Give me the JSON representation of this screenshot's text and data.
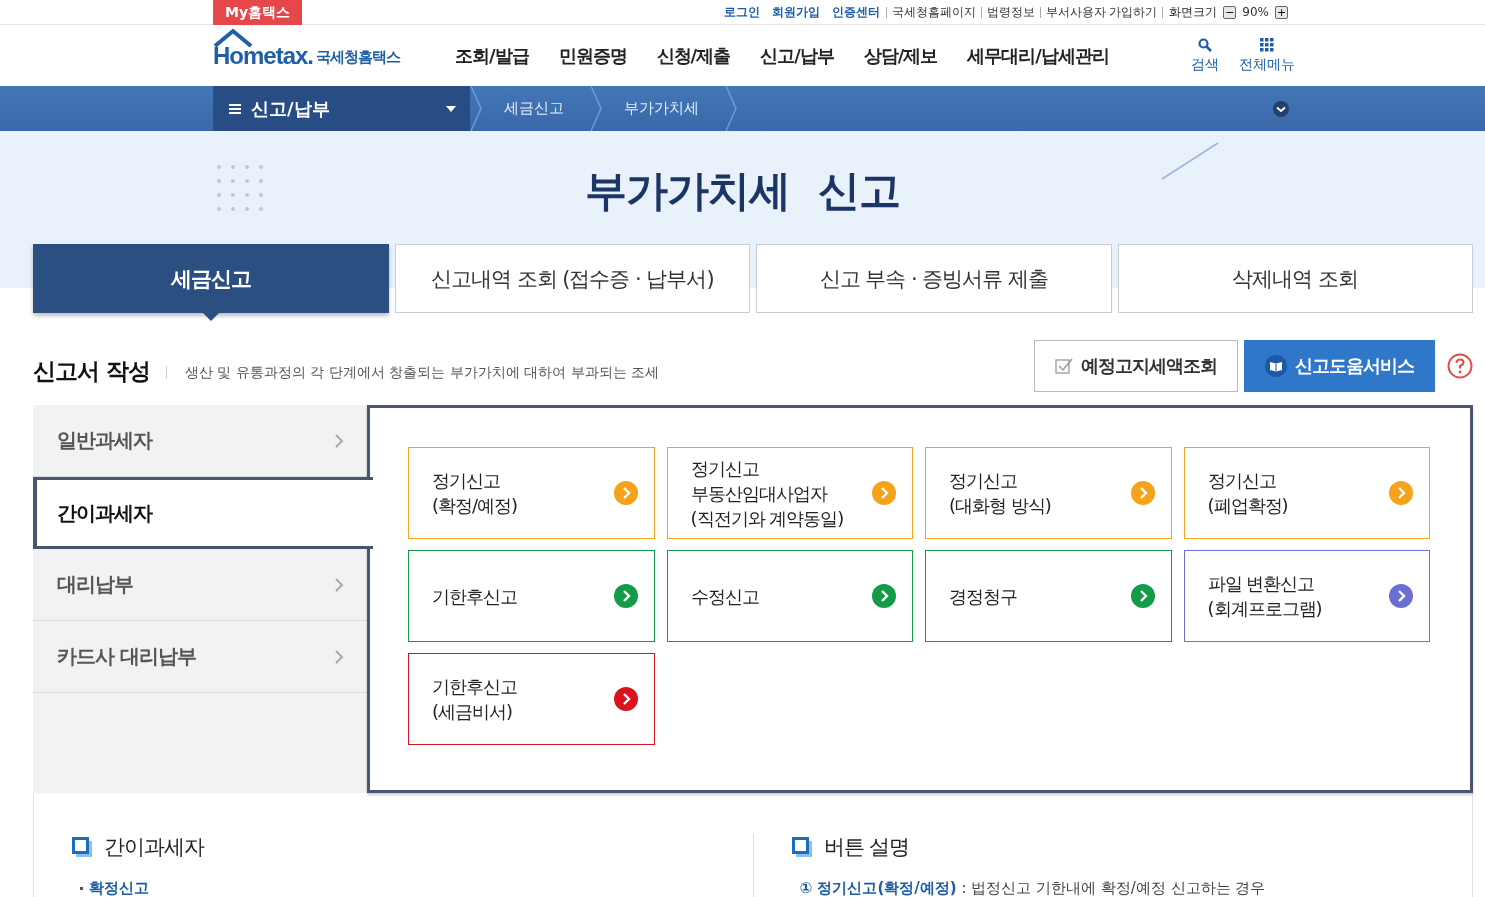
{
  "top_bar": {
    "badge": "My홈택스",
    "links": [
      {
        "label": "로그인",
        "emphasis": true
      },
      {
        "label": "회원가입",
        "emphasis": true
      },
      {
        "label": "인증센터",
        "emphasis": true
      },
      {
        "label": "국세청홈페이지",
        "emphasis": false
      },
      {
        "label": "법령정보",
        "emphasis": false
      },
      {
        "label": "부서사용자 가입하기",
        "emphasis": false
      }
    ],
    "zoom": {
      "label": "화면크기",
      "minus": "−",
      "value": "90%",
      "plus": "+"
    }
  },
  "header": {
    "logo": {
      "brand": "Hometax.",
      "name": "국세청홈택스"
    },
    "nav": [
      "조회/발급",
      "민원증명",
      "신청/제출",
      "신고/납부",
      "상담/제보",
      "세무대리/납세관리"
    ],
    "tools": [
      {
        "kind": "search",
        "label": "검색"
      },
      {
        "kind": "grid",
        "label": "전체메뉴"
      }
    ]
  },
  "breadcrumb": {
    "menu": "신고/납부",
    "items": [
      "세금신고",
      "부가가치세"
    ]
  },
  "banner": {
    "title": "부가가치세  신고"
  },
  "tabs": [
    {
      "label": "세금신고",
      "selected": true
    },
    {
      "label": "신고내역 조회 (접수증 · 납부서)",
      "selected": false
    },
    {
      "label": "신고 부속 · 증빙서류 제출",
      "selected": false
    },
    {
      "label": "삭제내역 조회",
      "selected": false
    }
  ],
  "section": {
    "title": "신고서 작성",
    "description": "생산 및 유통과정의 각 단계에서 창출되는 부가가치에 대하여 부과되는 조세",
    "buttons": [
      {
        "kind": "outline",
        "label": "예정고지세액조회"
      },
      {
        "kind": "primary",
        "label": "신고도움서비스"
      }
    ]
  },
  "side_menu": [
    {
      "label": "일반과세자",
      "selected": false
    },
    {
      "label": "간이과세자",
      "selected": true
    },
    {
      "label": "대리납부",
      "selected": false
    },
    {
      "label": "카드사 대리납부",
      "selected": false
    }
  ],
  "cards": [
    {
      "label": "정기신고\n(확정/예정)",
      "color": "#f5a31a"
    },
    {
      "label": "정기신고\n부동산임대사업자\n(직전기와 계약동일)",
      "color": "#f5a31a"
    },
    {
      "label": "정기신고\n(대화형 방식)",
      "color": "#f5a31a"
    },
    {
      "label": "정기신고\n(폐업확정)",
      "color": "#f5a31a"
    },
    {
      "label": "기한후신고",
      "color": "#139b48"
    },
    {
      "label": "수정신고",
      "color": "#139b48"
    },
    {
      "label": "경정청구",
      "color": "#139b48"
    },
    {
      "label": "파일 변환신고\n(회계프로그램)",
      "color": "#6b6fd1"
    },
    {
      "label": "기한후신고\n(세금비서)",
      "color": "#d9141e"
    }
  ],
  "guide": [
    {
      "title": "간이과세자",
      "items": [
        "확정신고"
      ]
    },
    {
      "title": "버튼 설명",
      "items": [
        "**① 정기신고(확정/예정)** : 법정신고 기한내에 확정/예정 신고하는 경우"
      ]
    }
  ]
}
